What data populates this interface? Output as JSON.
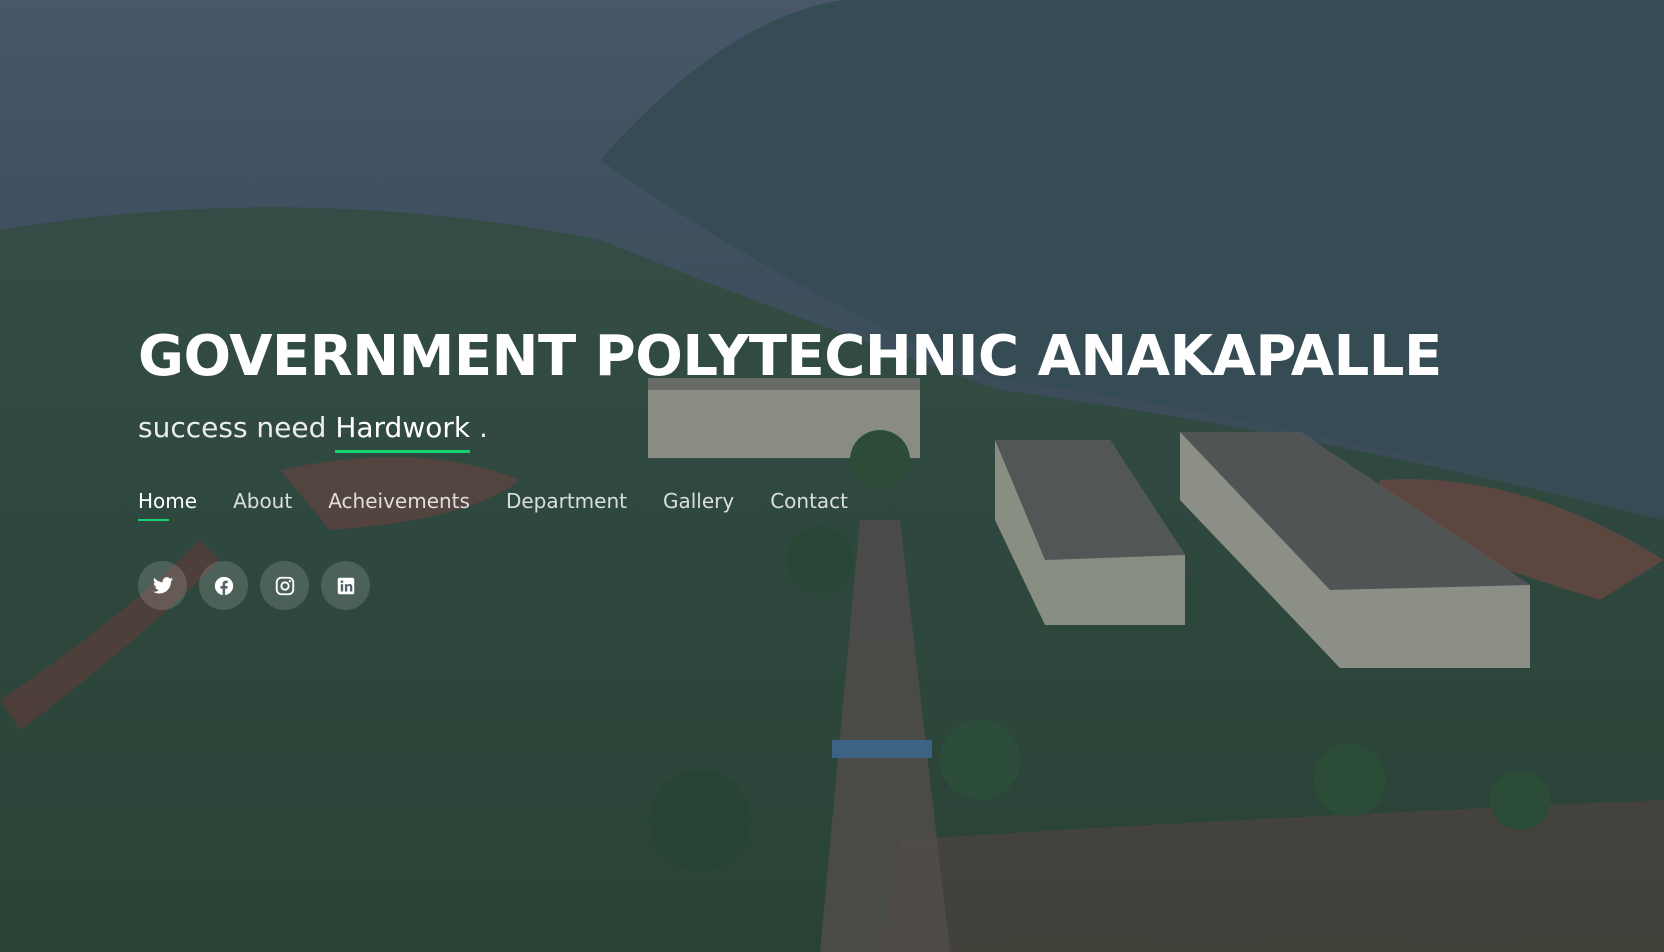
{
  "hero": {
    "title": "GOVERNMENT POLYTECHNIC ANAKAPALLE",
    "subtitle_prefix": "success need",
    "subtitle_typed": "Hardwork",
    "subtitle_suffix": ".",
    "accent_color": "#18d26e"
  },
  "nav": {
    "items": [
      {
        "label": "Home",
        "active": true
      },
      {
        "label": "About"
      },
      {
        "label": "Acheivements"
      },
      {
        "label": "Department"
      },
      {
        "label": "Gallery"
      },
      {
        "label": "Contact"
      }
    ]
  },
  "socials": [
    {
      "icon": "twitter-icon"
    },
    {
      "icon": "facebook-icon"
    },
    {
      "icon": "instagram-icon"
    },
    {
      "icon": "linkedin-icon"
    }
  ]
}
